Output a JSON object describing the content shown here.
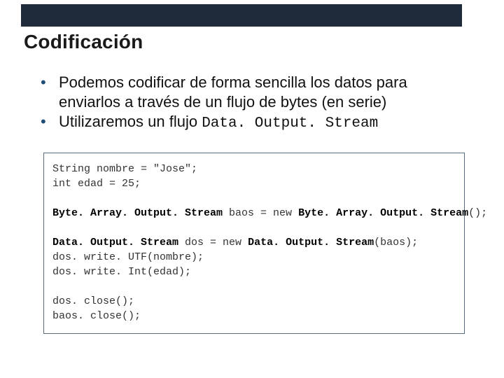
{
  "header": {
    "title": "Codificación"
  },
  "bullets": [
    {
      "text": "Podemos codificar de forma sencilla los datos para enviarlos a través de un flujo de bytes (en serie)"
    },
    {
      "text": "Utilizaremos un flujo ",
      "mono": "Data. Output. Stream"
    }
  ],
  "code": {
    "l1a": "String nombre = \"Jose\";",
    "l2a": "int edad = 25;",
    "l3a": "Byte. Array. Output. Stream",
    "l3b": " baos = new ",
    "l3c": "Byte. Array. Output. Stream",
    "l3d": "();",
    "l4a": "Data. Output. Stream",
    "l4b": " dos = new ",
    "l4c": "Data. Output. Stream",
    "l4d": "(baos);",
    "l5a": "dos. write. UTF(nombre);",
    "l6a": "dos. write. Int(edad);",
    "l7a": "dos. close();",
    "l8a": "baos. close();"
  }
}
